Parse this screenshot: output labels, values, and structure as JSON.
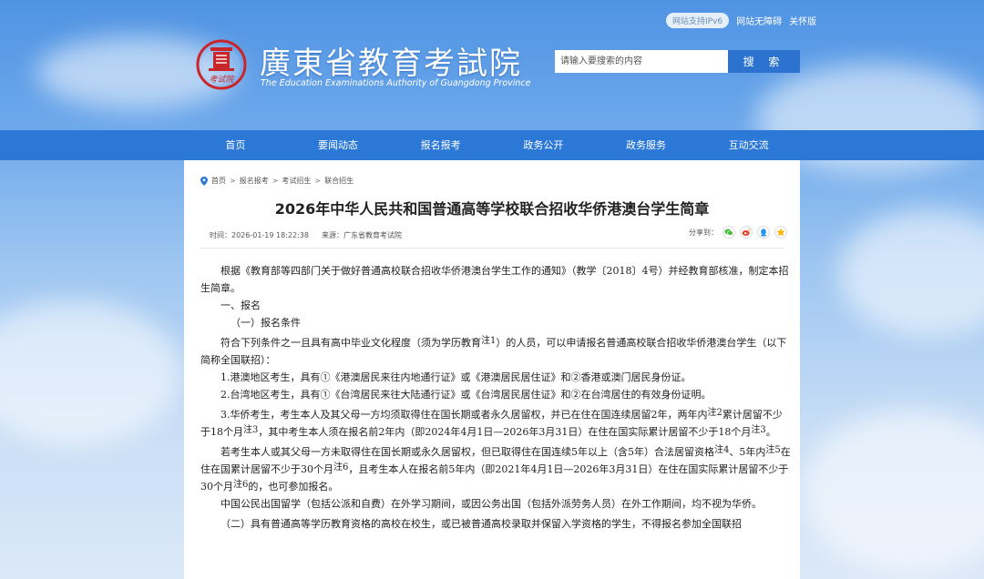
{
  "top_links": {
    "ipv6": "网站支持IPv6",
    "accessible": "网站无障碍",
    "elder": "关怀版"
  },
  "logo": {
    "seal_text": "考试院",
    "title": "廣東省教育考試院",
    "subtitle": "The Education Examinations Authority of Guangdong Province"
  },
  "search": {
    "placeholder": "请输入要搜索的内容",
    "button": "搜 索"
  },
  "nav": [
    "首页",
    "要闻动态",
    "报名报考",
    "政务公开",
    "政务服务",
    "互动交流"
  ],
  "breadcrumb": [
    "首页",
    "报名报考",
    "考试招生",
    "联合招生"
  ],
  "breadcrumb_sep": ">",
  "article": {
    "title": "2026年中华人民共和国普通高等学校联合招收华侨港澳台学生简章",
    "time": "时间：2026-01-19 18:22:38",
    "source": "来源：广东省教育考试院",
    "share_label": "分享到：",
    "share_icons": [
      "wechat-icon",
      "weibo-icon",
      "qq-icon",
      "qzone-icon"
    ],
    "body": {
      "p1": "根据《教育部等四部门关于做好普通高校联合招收华侨港澳台学生工作的通知》（教学〔2018〕4号）并经教育部核准，制定本招生简章。",
      "p2": "一、报名",
      "p3": "（一）报名条件",
      "p4": {
        "a": "符合下列条件之一且具有高中毕业文化程度（须为学历教育",
        "sup1": "注1",
        "b": "）的人员，可以申请报名普通高校联合招收华侨港澳台学生（以下简称全国联招）："
      },
      "p5": "1.港澳地区考生，具有①《港澳居民来往内地通行证》或《港澳居民居住证》和②香港或澳门居民身份证。",
      "p6": "2.台湾地区考生，具有①《台湾居民来往大陆通行证》或《台湾居民居住证》和②在台湾居住的有效身份证明。",
      "p7": {
        "a": "3.华侨考生，考生本人及其父母一方均须取得住在国长期或者永久居留权，并已在住在国连续居留2年，两年内",
        "sup1": "注2",
        "b": "累计居留不少于18个月",
        "sup2": "注3",
        "c": "，其中考生本人须在报名前2年内（即2024年4月1日—2026年3月31日）在住在国实际累计居留不少于18个月",
        "sup3": "注3",
        "d": "。"
      },
      "p8": {
        "a": "若考生本人或其父母一方未取得住在国长期或永久居留权，但已取得住在国连续5年以上（含5年）合法居留资格",
        "sup1": "注4",
        "b": "、5年内",
        "sup2": "注5",
        "c": "在住在国累计居留不少于30个月",
        "sup3": "注6",
        "d": "，且考生本人在报名前5年内（即2021年4月1日—2026年3月31日）在住在国实际累计居留不少于30个月",
        "sup4": "注6",
        "e": "的，也可参加报名。"
      },
      "p9": "中国公民出国留学（包括公派和自费）在外学习期间，或因公务出国（包括外派劳务人员）在外工作期间，均不视为华侨。",
      "p10": "（二）具有普通高等学历教育资格的高校在校生，或已被普通高校录取并保留入学资格的学生，不得报名参加全国联招"
    }
  },
  "colors": {
    "nav": "#2b78d6",
    "search_button": "#2b73cf",
    "logo_red": "#c8262a"
  }
}
